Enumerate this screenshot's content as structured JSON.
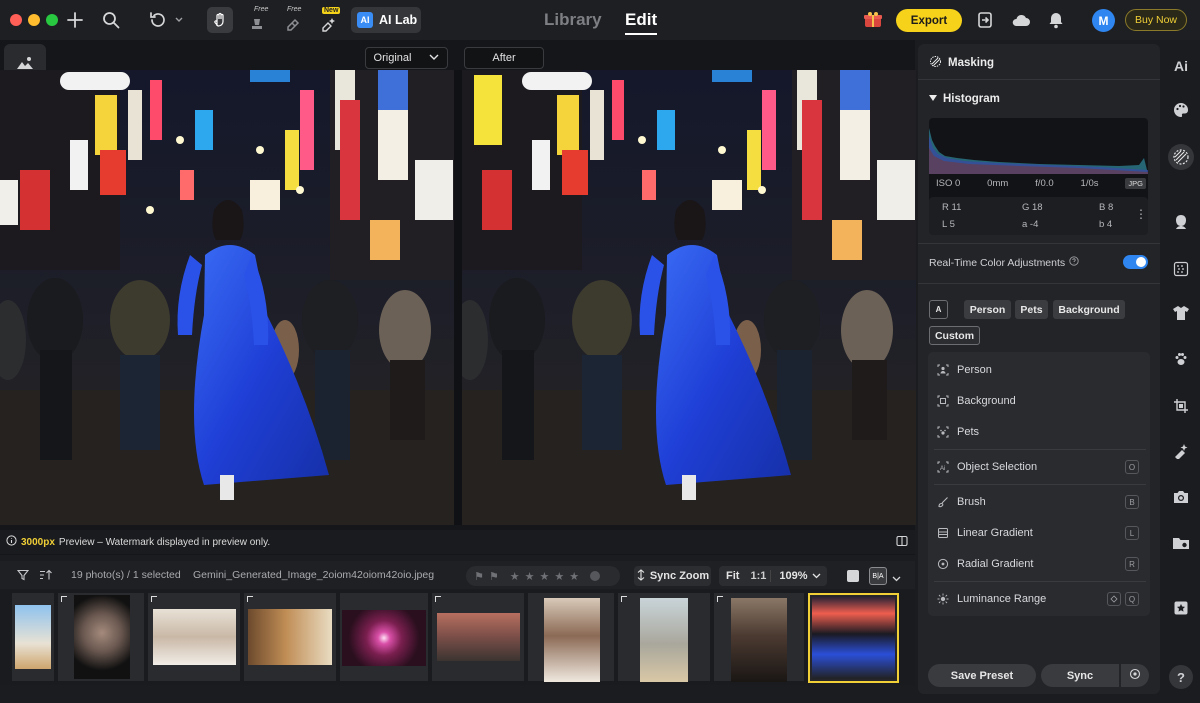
{
  "topbar": {
    "free_badge_1": "Free",
    "free_badge_2": "Free",
    "new_badge": "New",
    "ai_lab_label": "AI Lab",
    "ai_lab_icon_text": "AI",
    "mode_library": "Library",
    "mode_edit": "Edit",
    "export_label": "Export",
    "avatar_initial": "M",
    "buy_now_label": "Buy Now",
    "accent_color": "#f6d21b"
  },
  "canvas": {
    "before_label": "Original",
    "after_label": "After",
    "preview_px": "3000px",
    "preview_note": "Preview – Watermark displayed in preview only."
  },
  "filmstrip": {
    "count_text": "19 photo(s) / 1 selected",
    "filename": "Gemini_Generated_Image_2oiom42oiom42oio.jpeg",
    "sync_zoom_label": "Sync Zoom",
    "fit_label": "Fit",
    "one_to_one_label": "1:1",
    "zoom_value": "109%",
    "ba_label": "B|A"
  },
  "panel": {
    "masking_title": "Masking",
    "histogram_title": "Histogram",
    "iso": "ISO 0",
    "focal": "0mm",
    "aperture": "f/0.0",
    "shutter": "1/0s",
    "format": "JPG",
    "r": "R 11",
    "g": "G 18",
    "b": "B 8",
    "l": "L 5",
    "a": "a -4",
    "b2": "b 4",
    "realtime_label": "Real-Time Color Adjustments",
    "chips": [
      "Person",
      "Pets",
      "Background",
      "Custom"
    ],
    "mask_items": [
      {
        "label": "Person",
        "key": ""
      },
      {
        "label": "Background",
        "key": ""
      },
      {
        "label": "Pets",
        "key": ""
      },
      {
        "label": "Object Selection",
        "key": "O"
      },
      {
        "label": "Brush",
        "key": "B"
      },
      {
        "label": "Linear Gradient",
        "key": "L"
      },
      {
        "label": "Radial Gradient",
        "key": "R"
      },
      {
        "label": "Luminance Range",
        "key": "Q"
      }
    ],
    "save_preset_label": "Save Preset",
    "sync_label": "Sync"
  },
  "far_rail": {
    "ai_label": "Ai",
    "help_label": "?"
  }
}
